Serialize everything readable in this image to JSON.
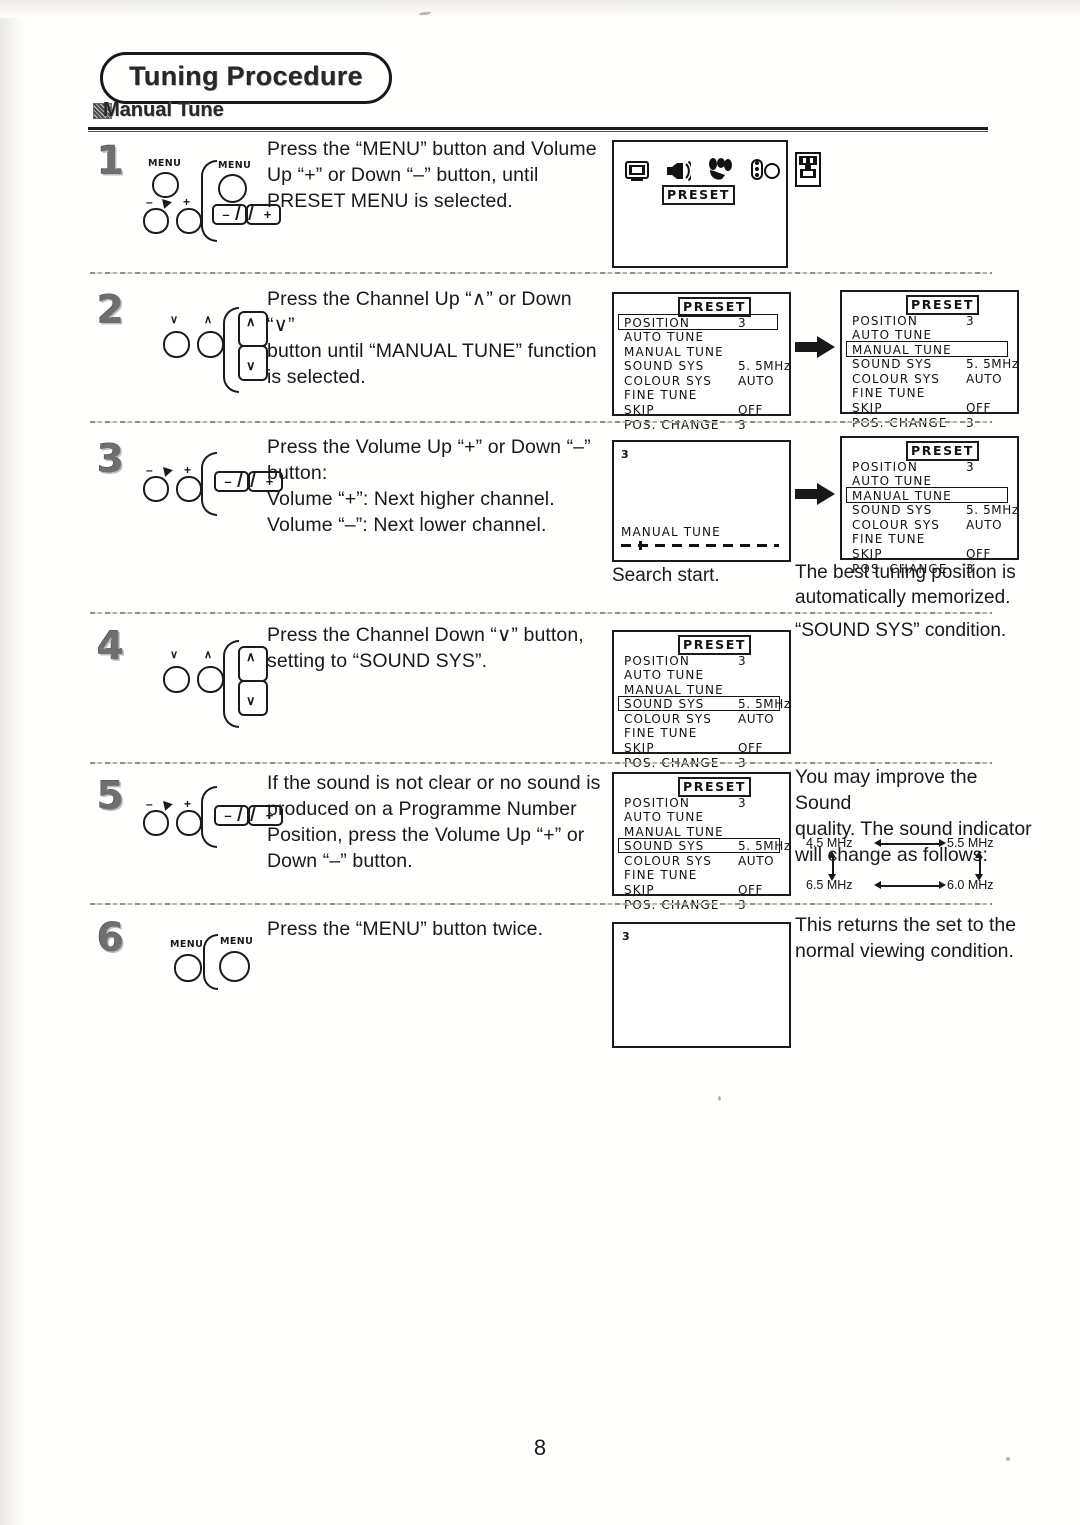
{
  "document": {
    "title": "Tuning Procedure",
    "section": "Manual Tune",
    "page_number": "8"
  },
  "osd_menu": {
    "header": "PRESET",
    "rows": [
      {
        "label": "POSITION",
        "value": "3"
      },
      {
        "label": "AUTO TUNE",
        "value": ""
      },
      {
        "label": "MANUAL TUNE",
        "value": ""
      },
      {
        "label": "SOUND SYS",
        "value": "5. 5MHz"
      },
      {
        "label": "COLOUR SYS",
        "value": "AUTO"
      },
      {
        "label": "FINE TUNE",
        "value": ""
      },
      {
        "label": "SKIP",
        "value": "OFF"
      },
      {
        "label": "POS. CHANGE",
        "value": "3"
      }
    ]
  },
  "steps": [
    {
      "number": "1",
      "instruction": "Press the “MENU” button and Volume Up “+” or Down “–” button, until PRESET MENU is selected.",
      "instruction_lines": [
        "Press the “MENU” button and Volume",
        "Up “+” or Down “–” button, until",
        "PRESET MENU is selected."
      ],
      "controls": {
        "set_button_label": "MENU",
        "remote_button_label": "MENU",
        "volume_minus": "–",
        "volume_plus": "+"
      },
      "screen": {
        "type": "icon-bar",
        "selected_label": "PRESET",
        "icons": [
          "picture-icon",
          "sound-icon",
          "feature-icon",
          "timer-icon",
          "preset-icon"
        ],
        "selected_icon": "preset-icon"
      }
    },
    {
      "number": "2",
      "instruction_lines": [
        "Press the Channel Up “∧” or Down “∨”",
        "button until “MANUAL TUNE” function",
        "is selected."
      ],
      "controls": {
        "channel_down": "∨",
        "channel_up": "∧"
      },
      "screen_left_highlight": "POSITION",
      "screen_right_highlight": "MANUAL TUNE"
    },
    {
      "number": "3",
      "instruction_lines": [
        "Press the Volume Up “+” or Down “–”",
        "button:",
        "Volume “+”:  Next higher channel.",
        "Volume “–”:  Next lower channel."
      ],
      "controls": {
        "volume_minus": "–",
        "volume_plus": "+"
      },
      "search_screen": {
        "position_number": "3",
        "mode_label": "MANUAL TUNE"
      },
      "caption_left": "Search start.",
      "caption_right_lines": [
        "The best tuning position is",
        "automatically memorized."
      ],
      "screen_right_highlight": "MANUAL TUNE"
    },
    {
      "number": "4",
      "instruction_lines": [
        "Press the Channel Down “∨” button,",
        "setting to “SOUND SYS”."
      ],
      "controls": {
        "channel_down": "∨",
        "channel_up": "∧"
      },
      "caption_right": "“SOUND SYS” condition.",
      "screen_highlight": "SOUND SYS"
    },
    {
      "number": "5",
      "instruction_lines": [
        "If the sound is not clear or no sound is",
        "produced on a Programme Number",
        "Position, press the Volume Up “+” or",
        "Down “–” button."
      ],
      "controls": {
        "volume_minus": "–",
        "volume_plus": "+"
      },
      "screen_highlight": "SOUND SYS",
      "note_lines": [
        "You may improve the Sound",
        "quality. The sound indicator",
        "will change as follows:"
      ],
      "sound_cycle": {
        "top_left": "4.5 MHz",
        "top_right": "5.5 MHz",
        "bottom_left": "6.5 MHz",
        "bottom_right": "6.0 MHz"
      }
    },
    {
      "number": "6",
      "instruction_lines": [
        "Press the “MENU” button twice."
      ],
      "controls": {
        "set_button_label": "MENU",
        "remote_button_label": "MENU"
      },
      "screen": {
        "position_number": "3"
      },
      "note_lines": [
        "This returns the set to the",
        "normal viewing condition."
      ]
    }
  ],
  "colors": {
    "ink": "#1a1a1a",
    "paper": "#fdfdfb",
    "gray_number": "#6f6f6f"
  }
}
